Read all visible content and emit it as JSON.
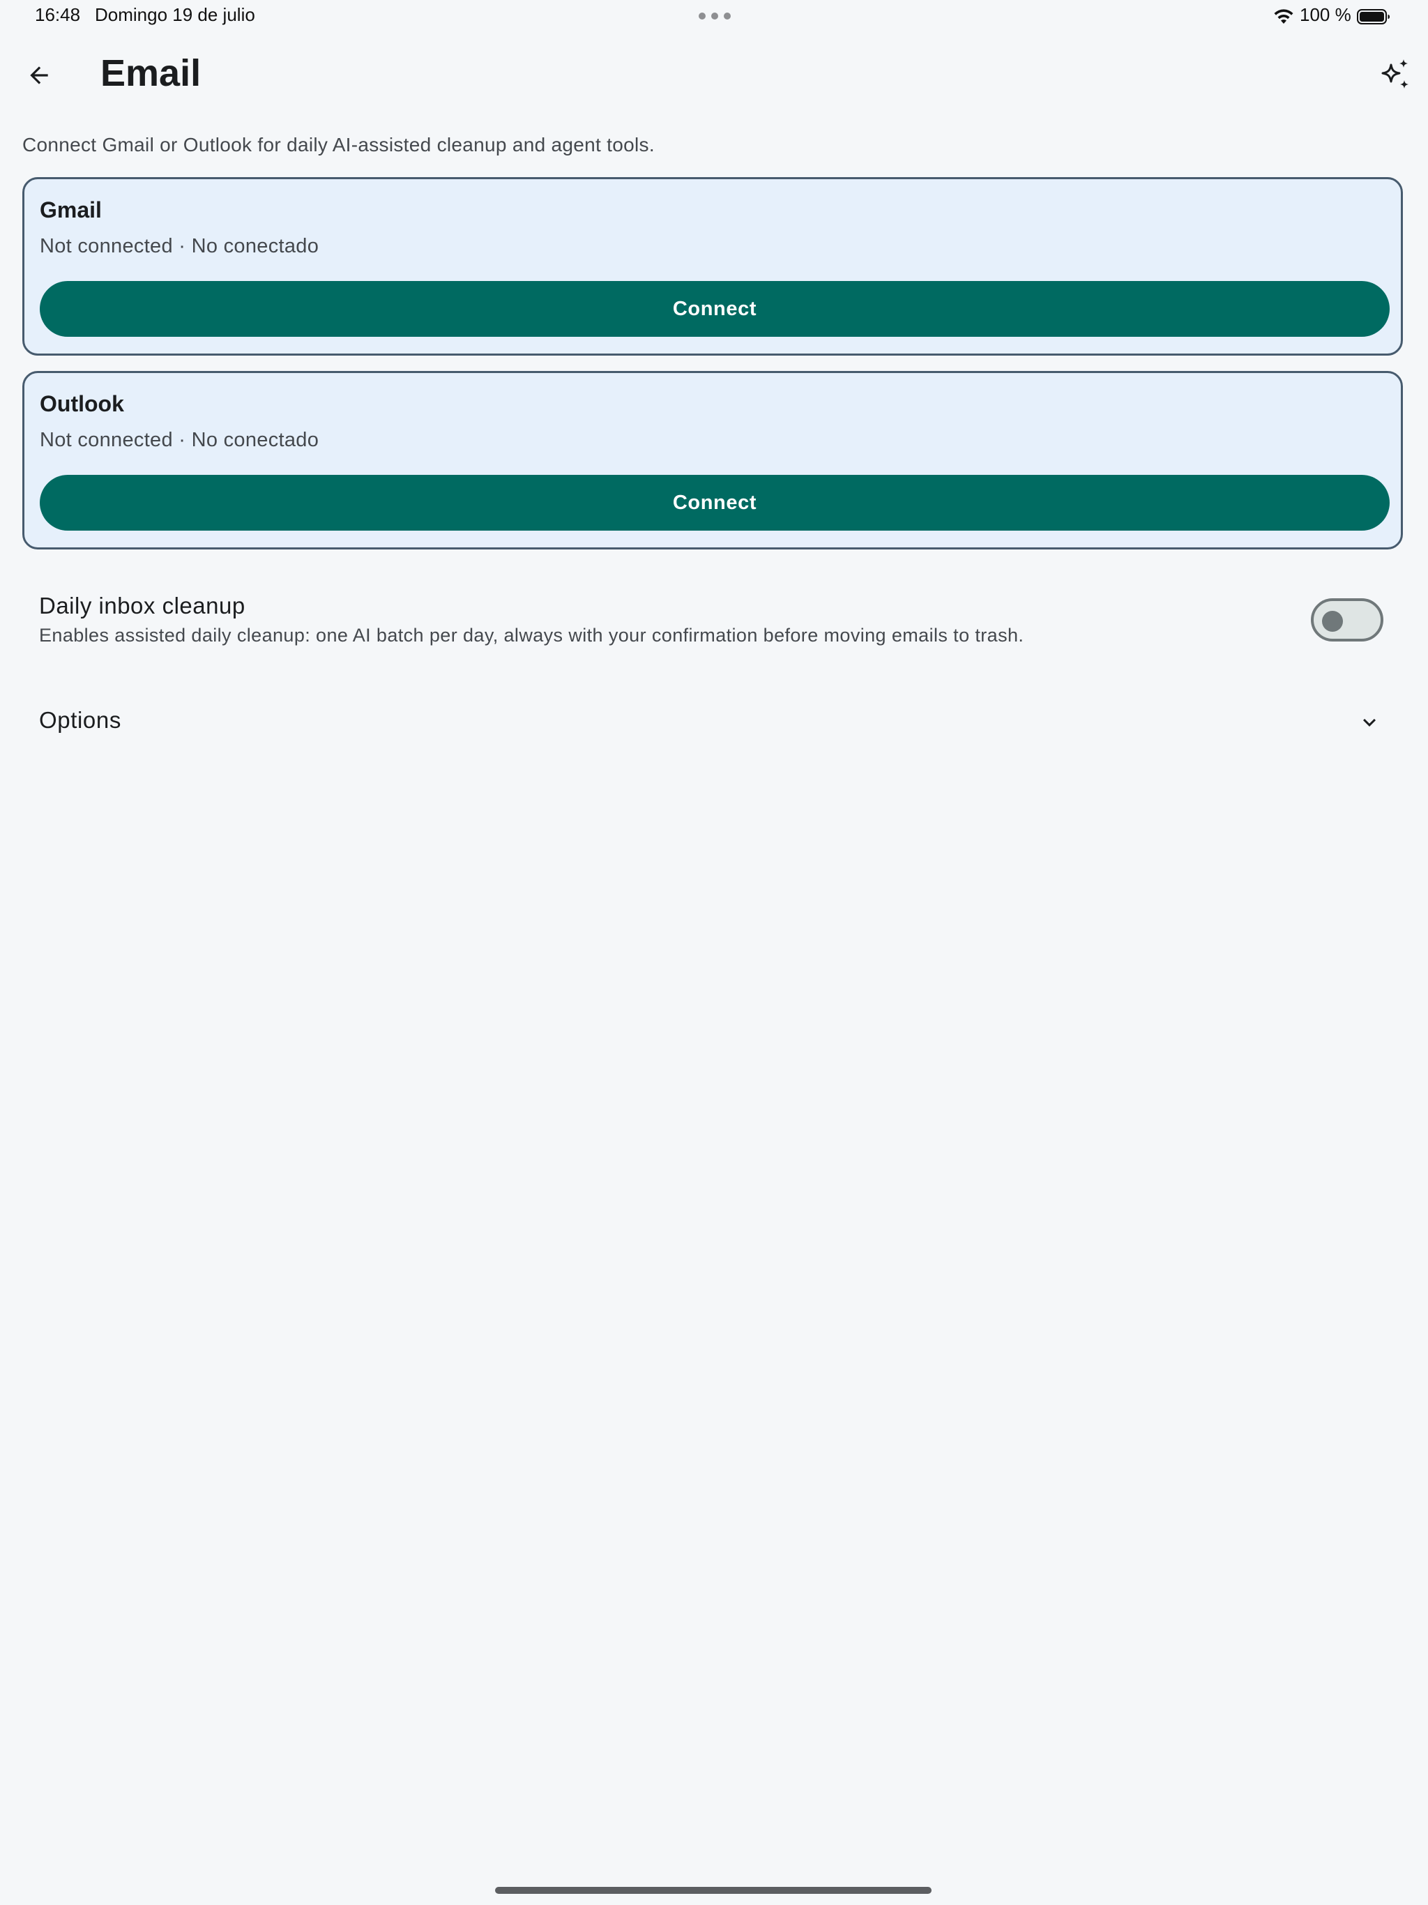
{
  "status_bar": {
    "time": "16:48",
    "date": "Domingo 19 de julio",
    "battery_text": "100 %",
    "icons": [
      "wifi-icon",
      "battery-icon",
      "more-dots-icon"
    ]
  },
  "app_bar": {
    "title": "Email",
    "back_icon": "arrow-back-icon",
    "assistant_icon": "sparkle-icon"
  },
  "intro_text": "Connect Gmail or Outlook for daily AI-assisted cleanup and agent tools.",
  "providers": [
    {
      "name": "Gmail",
      "status": "Not connected · No conectado",
      "button_label": "Connect"
    },
    {
      "name": "Outlook",
      "status": "Not connected · No conectado",
      "button_label": "Connect"
    }
  ],
  "daily_cleanup": {
    "title": "Daily inbox cleanup",
    "description": "Enables assisted daily cleanup: one AI batch per day, always with your confirmation before moving emails to trash.",
    "enabled": false
  },
  "options": {
    "label": "Options",
    "expanded": false,
    "icon": "chevron-down-icon"
  },
  "colors": {
    "accent": "#006a61",
    "card_background": "#e6f0fb",
    "card_border": "#475b6e",
    "page_background": "#f5f7f9"
  }
}
